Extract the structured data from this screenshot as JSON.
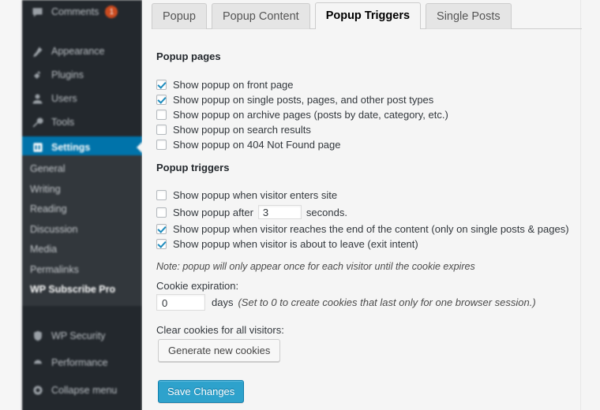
{
  "sidebar": {
    "top_items": [
      {
        "label": "Comments",
        "icon": "comments-icon",
        "badge": "1"
      },
      {
        "label": "Appearance",
        "icon": "appearance-icon",
        "badge": ""
      },
      {
        "label": "Plugins",
        "icon": "plugins-icon",
        "badge": ""
      },
      {
        "label": "Users",
        "icon": "users-icon",
        "badge": ""
      },
      {
        "label": "Tools",
        "icon": "tools-icon",
        "badge": ""
      },
      {
        "label": "Settings",
        "icon": "settings-icon",
        "badge": ""
      }
    ],
    "active_item": "Settings",
    "submenu": [
      {
        "label": "General",
        "current": false
      },
      {
        "label": "Writing",
        "current": false
      },
      {
        "label": "Reading",
        "current": false
      },
      {
        "label": "Discussion",
        "current": false
      },
      {
        "label": "Media",
        "current": false
      },
      {
        "label": "Permalinks",
        "current": false
      },
      {
        "label": "WP Subscribe Pro",
        "current": true
      }
    ],
    "bottom_items": [
      {
        "label": "WP Security",
        "icon": "shield-icon"
      },
      {
        "label": "Performance",
        "icon": "performance-icon"
      },
      {
        "label": "Collapse menu",
        "icon": "collapse-icon"
      }
    ],
    "colors": {
      "background": "#23282d",
      "submenu_background": "#32373c",
      "active": "#0073aa",
      "badge": "#ca4a1f"
    }
  },
  "tabs": [
    {
      "label": "Popup",
      "active": false
    },
    {
      "label": "Popup Content",
      "active": false
    },
    {
      "label": "Popup Triggers",
      "active": true
    },
    {
      "label": "Single Posts",
      "active": false
    }
  ],
  "popup_pages": {
    "title": "Popup pages",
    "options": [
      {
        "label": "Show popup on front page",
        "checked": true
      },
      {
        "label": "Show popup on single posts, pages, and other post types",
        "checked": true
      },
      {
        "label": "Show popup on archive pages (posts by date, category, etc.)",
        "checked": false
      },
      {
        "label": "Show popup on search results",
        "checked": false
      },
      {
        "label": "Show popup on 404 Not Found page",
        "checked": false
      }
    ]
  },
  "popup_triggers": {
    "title": "Popup triggers",
    "options": [
      {
        "label": "Show popup when visitor enters site",
        "checked": false
      },
      {
        "label_before": "Show popup after",
        "value": "3",
        "label_after": "seconds.",
        "checked": false
      },
      {
        "label": "Show popup when visitor reaches the end of the content (only on single posts & pages)",
        "checked": true
      },
      {
        "label": "Show popup when visitor is about to leave (exit intent)",
        "checked": true
      }
    ]
  },
  "note": "Note: popup will only appear once for each visitor until the cookie expires",
  "cookie": {
    "label": "Cookie expiration:",
    "value": "0",
    "days_word": "days",
    "hint": "(Set to 0 to create cookies that last only for one browser session.)"
  },
  "clear_cookies": {
    "label": "Clear cookies for all visitors:",
    "button": "Generate new cookies"
  },
  "save_button": "Save Changes",
  "accent_colors": {
    "primary_button": "#2ea2cc",
    "checkbox_check": "#1e8cbe"
  }
}
